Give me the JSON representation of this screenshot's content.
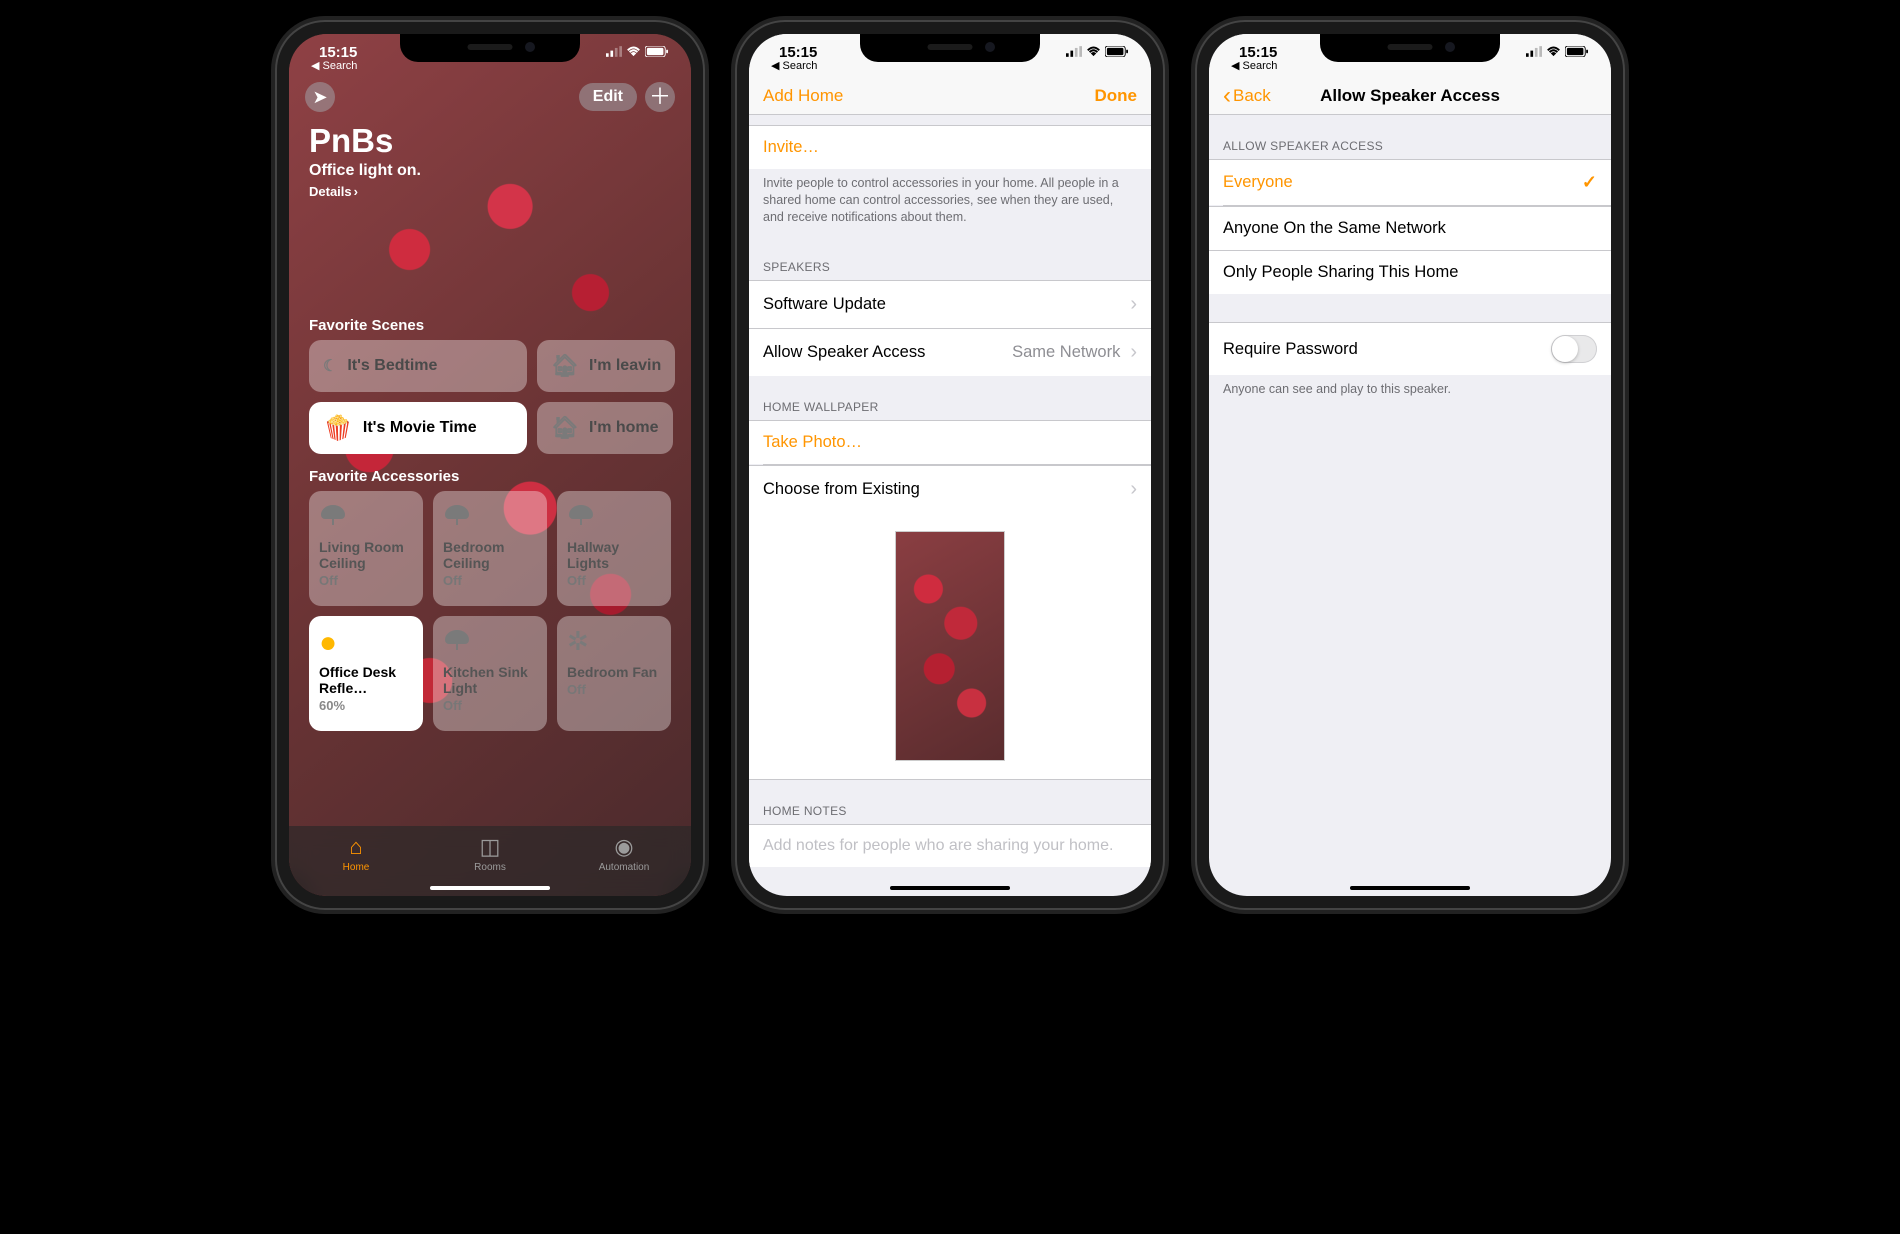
{
  "status": {
    "time": "15:15",
    "back_label": "Search"
  },
  "screen1": {
    "edit": "Edit",
    "home_name": "PnBs",
    "status_line": "Office light on.",
    "details": "Details",
    "scenes_header": "Favorite Scenes",
    "scenes": [
      {
        "icon": "moon-icon",
        "label": "It's Bedtime",
        "active": false
      },
      {
        "icon": "leaving-icon",
        "label": "I'm leavin",
        "active": false
      },
      {
        "icon": "popcorn-icon",
        "label": "It's Movie Time",
        "active": true
      },
      {
        "icon": "arrive-icon",
        "label": "I'm home",
        "active": false
      }
    ],
    "accessories_header": "Favorite Accessories",
    "accessories": [
      {
        "icon": "ceiling-light-icon",
        "name": "Living Room Ceiling",
        "state": "Off",
        "active": false
      },
      {
        "icon": "ceiling-light-icon",
        "name": "Bedroom Ceiling",
        "state": "Off",
        "active": false
      },
      {
        "icon": "ceiling-light-icon",
        "name": "Hallway Lights",
        "state": "Off",
        "active": false
      },
      {
        "icon": "bulb-icon",
        "name": "Office Desk Refle…",
        "state": "60%",
        "active": true
      },
      {
        "icon": "ceiling-light-icon",
        "name": "Kitchen Sink Light",
        "state": "Off",
        "active": false
      },
      {
        "icon": "fan-icon",
        "name": "Bedroom Fan",
        "state": "Off",
        "active": false
      }
    ],
    "tabs": [
      {
        "icon": "home-tab-icon",
        "label": "Home",
        "active": true
      },
      {
        "icon": "rooms-tab-icon",
        "label": "Rooms",
        "active": false
      },
      {
        "icon": "automation-tab-icon",
        "label": "Automation",
        "active": false
      }
    ]
  },
  "screen2": {
    "nav_left": "Add Home",
    "nav_right": "Done",
    "invite": "Invite…",
    "invite_footer": "Invite people to control accessories in your home. All people in a shared home can control accessories, see when they are used, and receive notifications about them.",
    "speakers_header": "SPEAKERS",
    "software_update": "Software Update",
    "allow_access_label": "Allow Speaker Access",
    "allow_access_value": "Same Network",
    "wallpaper_header": "HOME WALLPAPER",
    "take_photo": "Take Photo…",
    "choose_existing": "Choose from Existing",
    "notes_header": "HOME NOTES",
    "notes_placeholder": "Add notes for people who are sharing your home."
  },
  "screen3": {
    "back": "Back",
    "title": "Allow Speaker Access",
    "header": "ALLOW SPEAKER ACCESS",
    "options": [
      {
        "label": "Everyone",
        "selected": true
      },
      {
        "label": "Anyone On the Same Network",
        "selected": false
      },
      {
        "label": "Only People Sharing This Home",
        "selected": false
      }
    ],
    "require_password": "Require Password",
    "footer": "Anyone can see and play to this speaker."
  }
}
